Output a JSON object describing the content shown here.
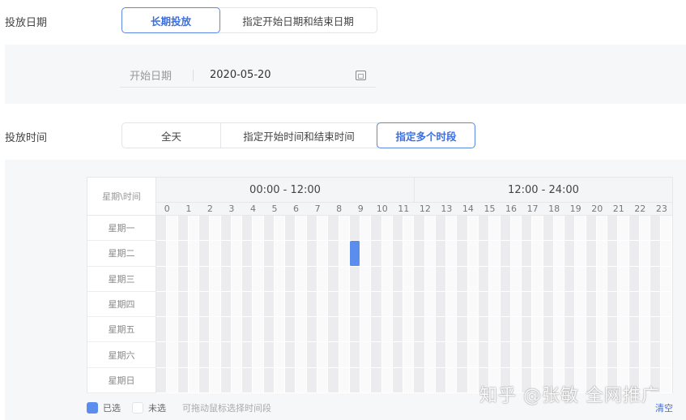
{
  "date_section": {
    "label": "投放日期",
    "options": [
      "长期投放",
      "指定开始日期和结束日期"
    ],
    "active": 0,
    "start_label": "开始日期",
    "start_value": "2020-05-20"
  },
  "time_section": {
    "label": "投放时间",
    "options": [
      "全天",
      "指定开始时间和结束时间",
      "指定多个时段"
    ],
    "active": 2
  },
  "schedule": {
    "corner": "星期\\时间",
    "halves": [
      "00:00 - 12:00",
      "12:00 - 24:00"
    ],
    "hours": [
      "0",
      "1",
      "2",
      "3",
      "4",
      "5",
      "6",
      "7",
      "8",
      "9",
      "10",
      "11",
      "12",
      "13",
      "14",
      "15",
      "16",
      "17",
      "18",
      "19",
      "20",
      "21",
      "22",
      "23"
    ],
    "days": [
      "星期一",
      "星期二",
      "星期三",
      "星期四",
      "星期五",
      "星期六",
      "星期日"
    ],
    "selected": [
      {
        "day": 1,
        "slot": "09:00-09:30"
      }
    ]
  },
  "legend": {
    "selected": "已选",
    "unselected": "未选",
    "hint": "可拖动鼠标选择时间段",
    "clear": "清空"
  },
  "colors": {
    "accent": "#3d6fe0",
    "selected": "#5b8def"
  },
  "watermark": "知乎 @张敏 全网推广"
}
